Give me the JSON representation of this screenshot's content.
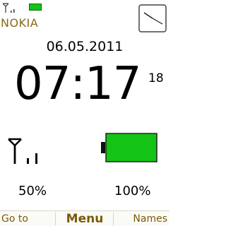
{
  "status_bar": {
    "operator": "NOKIA",
    "signal_icon": "signal-strength-icon",
    "battery_icon": "battery-icon",
    "clock_icon": "analog-clock-icon"
  },
  "clock": {
    "date": "06.05.2011",
    "time": "07:17",
    "seconds": "18"
  },
  "indicators": {
    "signal_percent": "50%",
    "battery_percent": "100%",
    "battery_color": "#14c414",
    "signal_level": 0.5,
    "battery_level": 1.0
  },
  "softkeys": {
    "left": "Go to",
    "center": "Menu",
    "right": "Names",
    "color": "#7a5a0a"
  }
}
